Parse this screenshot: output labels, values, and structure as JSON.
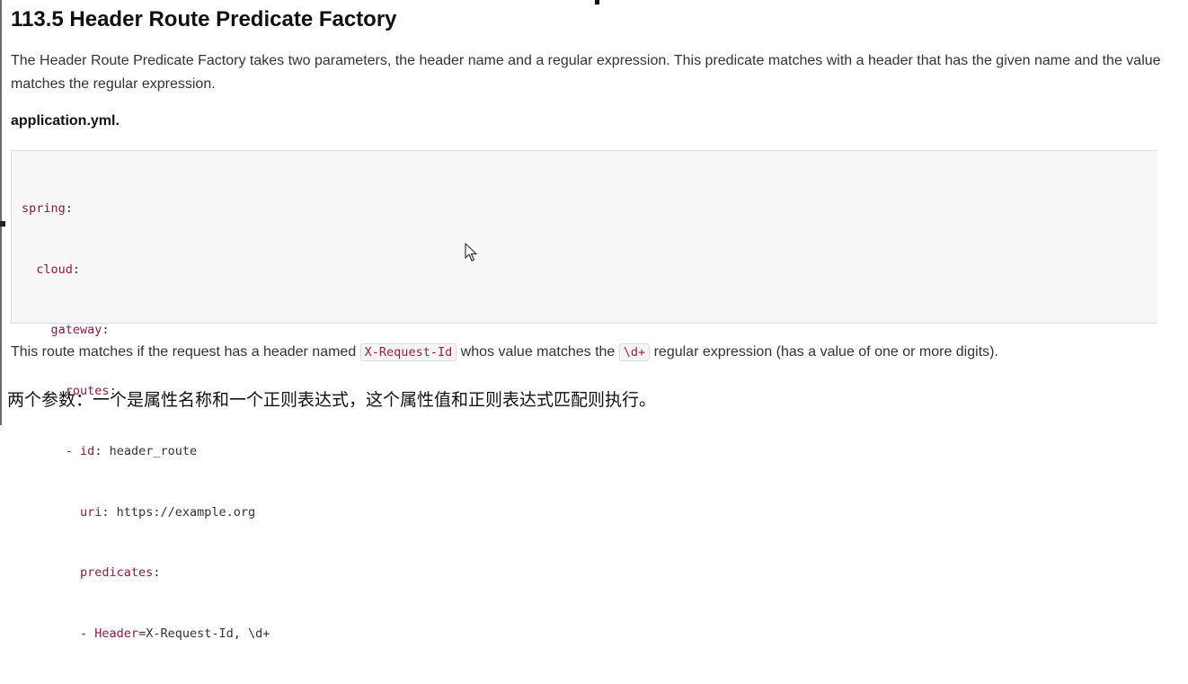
{
  "heading": "113.5 Header Route Predicate Factory",
  "intro": "The Header Route Predicate Factory takes two parameters, the header name and a regular expression. This predicate matches with a header that has the given name and the value matches the regular expression.",
  "caption": "application.yml.",
  "code": {
    "line1_key": "spring",
    "line1_punct": ":",
    "line2_indent": "  ",
    "line2_key": "cloud",
    "line2_punct": ":",
    "line3_indent": "    ",
    "line3_key": "gateway",
    "line3_punct": ":",
    "line4_indent": "      ",
    "line4_key": "routes",
    "line4_punct": ":",
    "line5_indent": "      ",
    "line5_dash": "- ",
    "line5_key": "id",
    "line5_value": ": header_route",
    "line6_indent": "        ",
    "line6_key": "uri",
    "line6_value": ": https://example.org",
    "line7_indent": "        ",
    "line7_key": "predicates",
    "line7_punct": ":",
    "line8_indent": "        ",
    "line8_dash": "- ",
    "line8_key": "Header",
    "line8_value": "=X-Request-Id, \\d+"
  },
  "explanation": {
    "part1": "This route matches if the request has a header named ",
    "code1": "X-Request-Id",
    "part2": " whos value matches the ",
    "code2": "\\d+",
    "part3": " regular expression (has a value of one or more digits)."
  },
  "chinese_note": "两个参数：一个是属性名称和一个正则表达式，这个属性值和正则表达式匹配则执行。",
  "colors": {
    "yaml_key": "#8b1a4a",
    "inline_code": "#9b2335",
    "code_background": "#f7f7f7"
  },
  "icons": {
    "cursor": "mouse-pointer-icon"
  }
}
